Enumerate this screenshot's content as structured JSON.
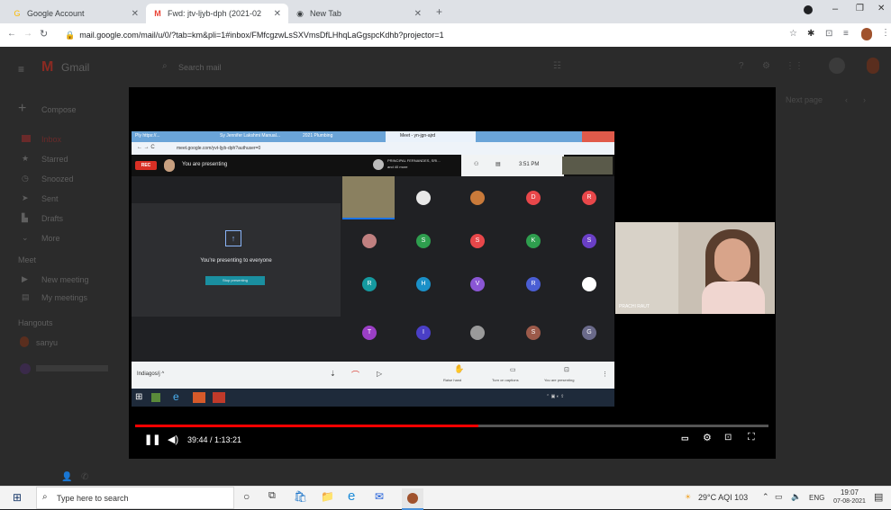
{
  "browser": {
    "tabs": [
      {
        "title": "Google Account",
        "icon": "google-g-icon",
        "color": "#fbbc04"
      },
      {
        "title": "Fwd: jtv-ljyb-dph (2021-02",
        "icon": "gmail-icon",
        "color": "#ea4335"
      },
      {
        "title": "New Tab",
        "icon": "new-tab-icon",
        "color": "#5f6368"
      }
    ],
    "url": "mail.google.com/mail/u/0/?tab=km&pli=1#inbox/FMfcgzwLsSXVmsDfLHhqLaGgspcKdhb?projector=1"
  },
  "gmail": {
    "logo_text": "Gmail",
    "search_placeholder": "Search mail",
    "compose": "Compose",
    "menu": [
      "Inbox",
      "Starred",
      "Snoozed",
      "Sent",
      "Drafts",
      "More"
    ],
    "meet_heading": "Meet",
    "meet_items": [
      "New meeting",
      "My meetings"
    ],
    "hangouts_heading": "Hangouts",
    "hangouts_user": "sanyu",
    "page_text": "Next page"
  },
  "inner_meet": {
    "tabs": [
      "Ply https://...",
      "Sy Jennifer Lakshmi Manual...",
      "2021 Plumbing",
      "Meet - yn-jgn-ajrd"
    ],
    "url_text": "meet.google.com/yvt-ljyb-dph?authuser=0",
    "rec_label": "REC",
    "presenting_label": "You are presenting",
    "participants_header_top": "PRINCIPAL FERNANDES, SRI...",
    "participants_header_bottom": "and 40 more",
    "time": "3:51 PM",
    "presenting_everyone": "You're presenting to everyone",
    "stop_presenting": "Stop presenting",
    "meeting_code": "Indiagos/j ^",
    "tiles": [
      [
        "",
        "",
        "",
        "D",
        "R"
      ],
      [
        "",
        "S",
        "S",
        "K",
        "S"
      ],
      [
        "R",
        "H",
        "V",
        "R",
        ""
      ],
      [
        "T",
        "I",
        "",
        "S",
        "G"
      ]
    ],
    "tile_colors": [
      [
        "#7c7c7c",
        "#e8e8e8",
        "#c97a3a",
        "#e8474a",
        "#e8474a"
      ],
      [
        "#c08080",
        "#2e9e4e",
        "#e8474a",
        "#2e9e4e",
        "#6a3fc6"
      ],
      [
        "#159aa0",
        "#1a90c8",
        "#8a56d4",
        "#4a5ed4",
        "#ffffff"
      ],
      [
        "#9b3fc6",
        "#4a3fc6",
        "#9a9a9a",
        "#9c5a4a",
        "#6a6a8a"
      ]
    ],
    "buttons": {
      "raise_hand": "Raise hand",
      "captions": "Turn on captions",
      "present": "You are presenting"
    }
  },
  "video": {
    "time": "39:44 / 1:13:21",
    "progress_pct": 54.2,
    "participant_name": "PRACHI RAUT"
  },
  "taskbar": {
    "search_placeholder": "Type here to search",
    "weather": "29°C AQI 103",
    "lang": "ENG",
    "clock_time": "19:07",
    "clock_date": "07-08-2021"
  }
}
